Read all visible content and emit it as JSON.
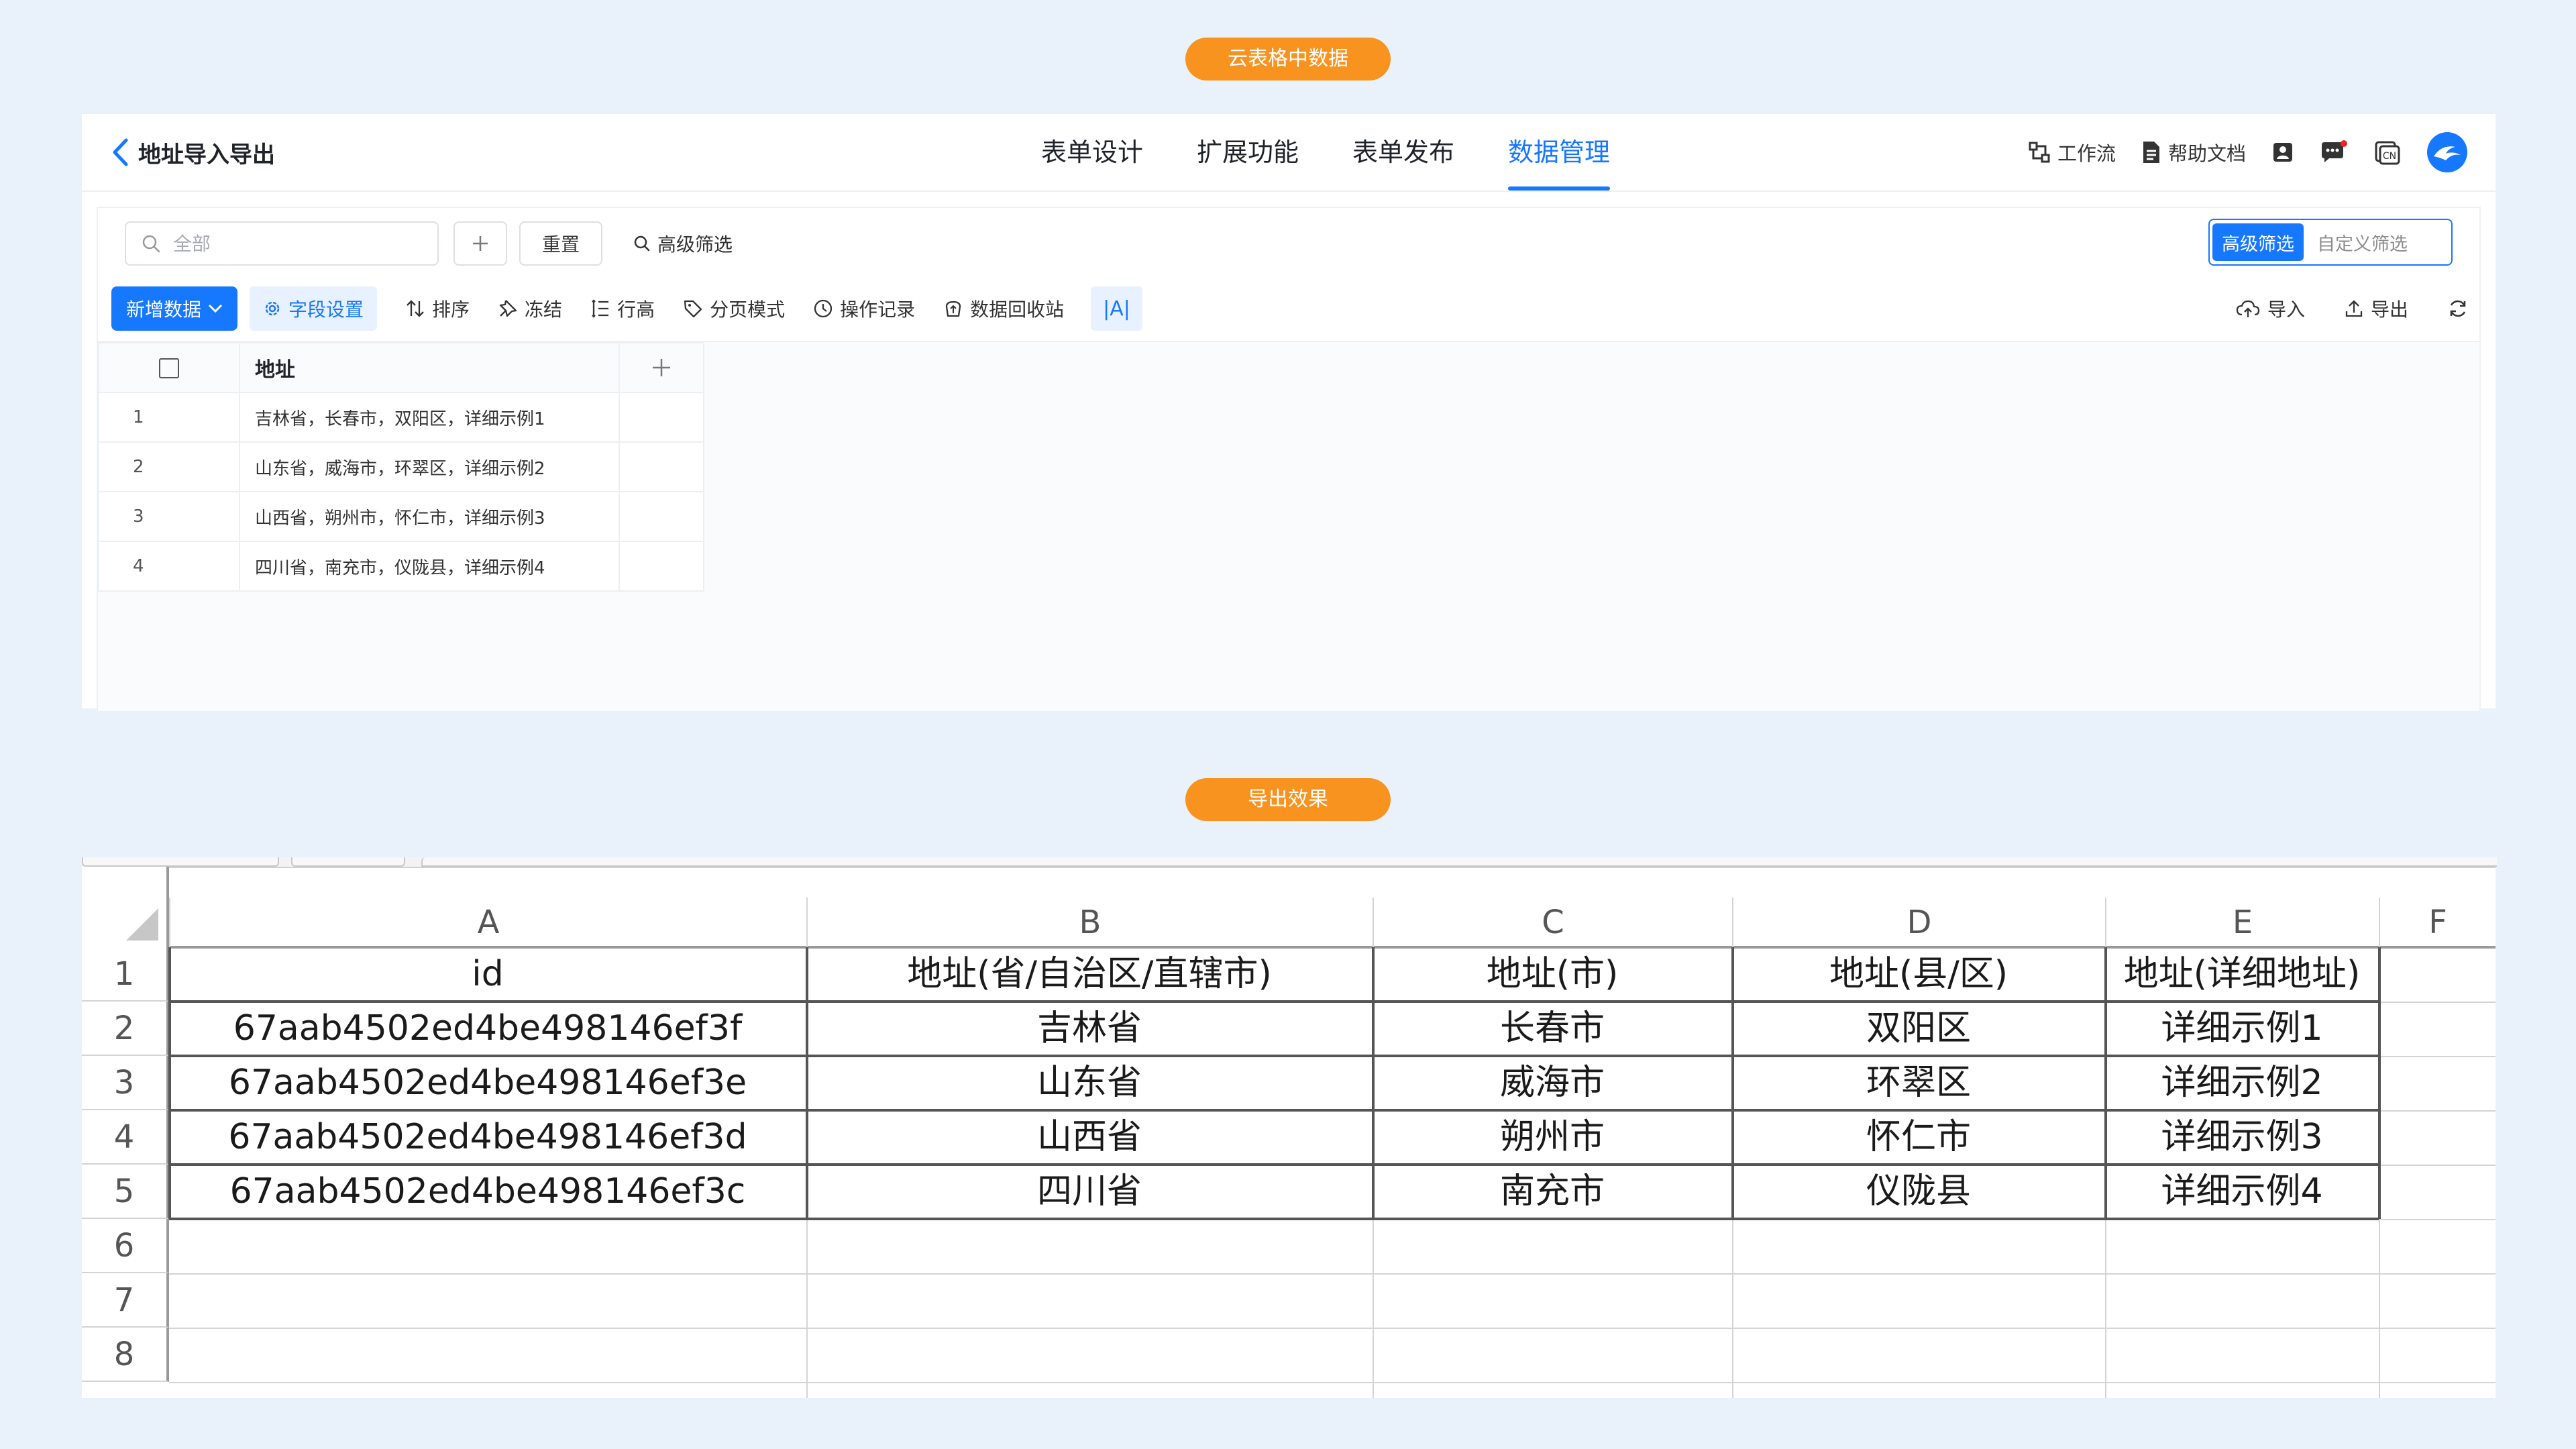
{
  "labels": {
    "top_pill": "云表格中数据",
    "bottom_pill": "导出效果"
  },
  "app": {
    "back_title": "地址导入导出",
    "nav": [
      "表单设计",
      "扩展功能",
      "表单发布",
      "数据管理"
    ],
    "nav_active_index": 3,
    "tools": {
      "workflow": "工作流",
      "help_docs": "帮助文档",
      "lang": "CN"
    },
    "filter": {
      "search_placeholder": "全部",
      "reset": "重置",
      "advanced": "高级筛选",
      "toggle_advanced": "高级筛选",
      "toggle_custom": "自定义筛选"
    },
    "toolbar": {
      "new_data": "新增数据",
      "field_settings": "字段设置",
      "sort": "排序",
      "freeze": "冻结",
      "row_height": "行高",
      "pagination": "分页模式",
      "op_log": "操作记录",
      "recycle": "数据回收站",
      "font_toggle": "|A|",
      "import": "导入",
      "export": "导出"
    },
    "grid": {
      "header": "地址",
      "rows": [
        {
          "index": "1",
          "address": "吉林省，长春市，双阳区，详细示例1"
        },
        {
          "index": "2",
          "address": "山东省，威海市，环翠区，详细示例2"
        },
        {
          "index": "3",
          "address": "山西省，朔州市，怀仁市，详细示例3"
        },
        {
          "index": "4",
          "address": "四川省，南充市，仪陇县，详细示例4"
        }
      ]
    }
  },
  "sheet": {
    "columns": [
      "A",
      "B",
      "C",
      "D",
      "E",
      "F"
    ],
    "row_numbers": [
      "1",
      "2",
      "3",
      "4",
      "5",
      "6",
      "7",
      "8"
    ],
    "rows": [
      [
        "id",
        "地址(省/自治区/直辖市)",
        "地址(市)",
        "地址(县/区)",
        "地址(详细地址)"
      ],
      [
        "67aab4502ed4be498146ef3f",
        "吉林省",
        "长春市",
        "双阳区",
        "详细示例1"
      ],
      [
        "67aab4502ed4be498146ef3e",
        "山东省",
        "威海市",
        "环翠区",
        "详细示例2"
      ],
      [
        "67aab4502ed4be498146ef3d",
        "山西省",
        "朔州市",
        "怀仁市",
        "详细示例3"
      ],
      [
        "67aab4502ed4be498146ef3c",
        "四川省",
        "南充市",
        "仪陇县",
        "详细示例4"
      ]
    ]
  },
  "colors": {
    "accent": "#1677ff",
    "pill": "#f7931e",
    "page_bg": "#e9f2fb"
  }
}
